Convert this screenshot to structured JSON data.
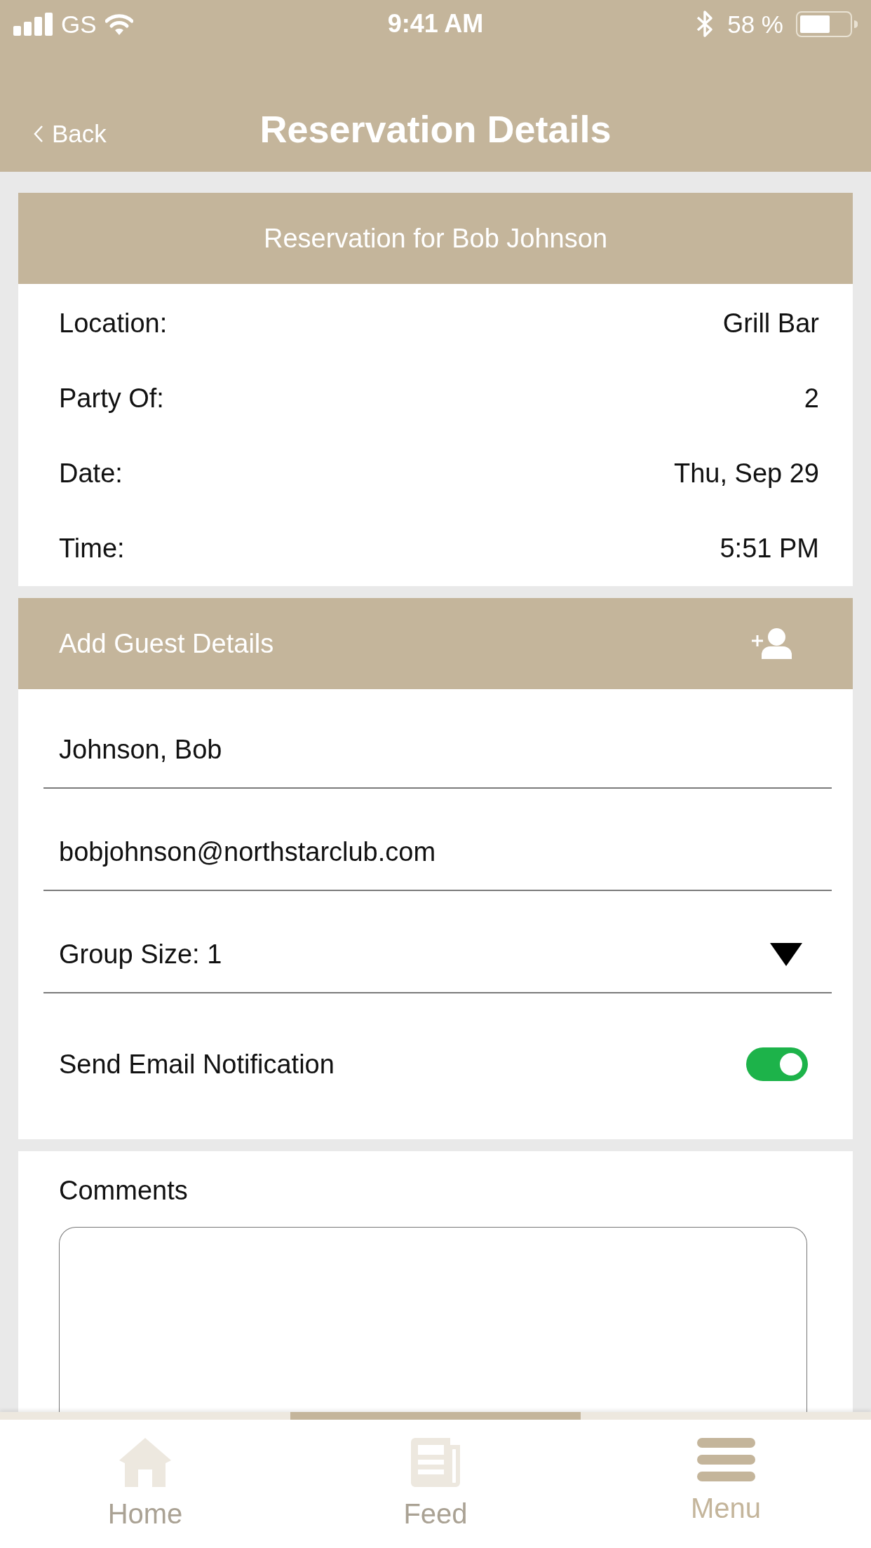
{
  "status_bar": {
    "carrier": "GS",
    "time": "9:41 AM",
    "battery": "58 %"
  },
  "nav_bar": {
    "back": "Back",
    "title": "Reservation Details"
  },
  "reservation": {
    "title": "Reservation for Bob Johnson",
    "details": [
      {
        "label": "Location:",
        "value": "Grill Bar"
      },
      {
        "label": "Party Of:",
        "value": "2"
      },
      {
        "label": "Date:",
        "value": "Thu, Sep 29"
      },
      {
        "label": "Time:",
        "value": "5:51 PM"
      }
    ]
  },
  "guest_details": {
    "title": "Add Guest Details",
    "fields": [
      {
        "kind": "name",
        "value": "Johnson, Bob"
      },
      {
        "kind": "email",
        "value": "bobjohnson@northstarclub.com"
      },
      {
        "kind": "select",
        "value": "Group Size: 1"
      }
    ],
    "notification": {
      "label": "Send Email Notification",
      "on": true
    }
  },
  "comments": {
    "label": "Comments"
  },
  "tab_bar": [
    {
      "kind": "home",
      "label": "Home",
      "selected": false
    },
    {
      "kind": "feed",
      "label": "Feed",
      "selected": false
    },
    {
      "kind": "menu",
      "label": "Menu",
      "selected": true
    }
  ]
}
